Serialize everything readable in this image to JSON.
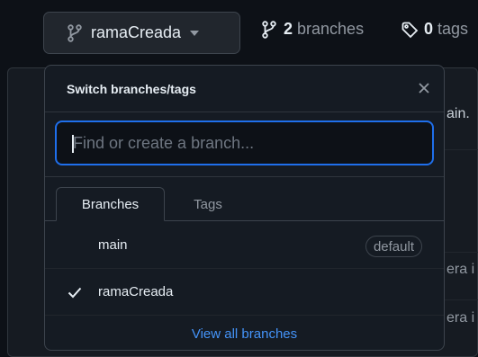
{
  "top": {
    "current_branch": "ramaCreada",
    "branches_count": "2",
    "branches_word": "branches",
    "tags_count": "0",
    "tags_word": "tags"
  },
  "background": {
    "line1": "ain.",
    "line2": "era i",
    "line3": "era i"
  },
  "popup": {
    "title": "Switch branches/tags",
    "search_placeholder": "Find or create a branch...",
    "tabs": [
      {
        "label": "Branches",
        "active": true
      },
      {
        "label": "Tags",
        "active": false
      }
    ],
    "branches": [
      {
        "name": "main",
        "badge": "default",
        "selected": false
      },
      {
        "name": "ramaCreada",
        "badge": "",
        "selected": true
      }
    ],
    "view_all_label": "View all branches"
  },
  "colors": {
    "page_bg": "#0d1117",
    "popup_bg": "#151b23",
    "border": "#3d444d",
    "focus_ring": "#1f6feb",
    "link": "#4493f8",
    "muted_text": "#9198a1"
  },
  "icons": {
    "branch": "git-branch-icon",
    "caret": "triangle-down-icon",
    "tag": "tag-icon",
    "close": "close-icon",
    "check": "check-icon"
  }
}
